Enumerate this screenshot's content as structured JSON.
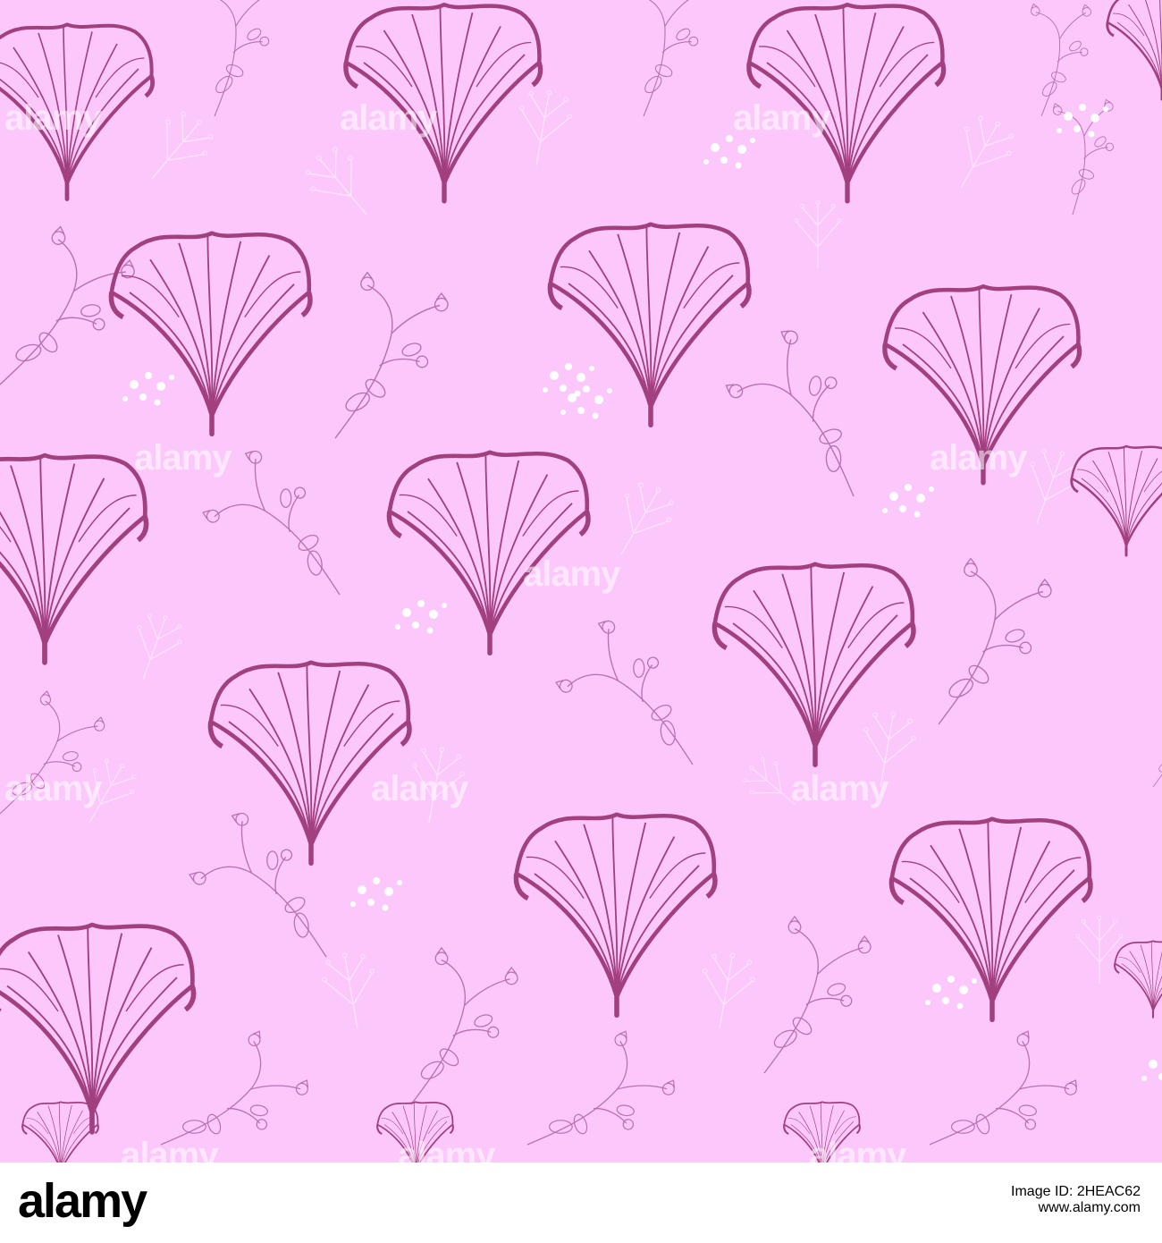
{
  "image": {
    "description": "Seamless pattern of ginkgo-like fan leaves with small wildflower sprigs on a pink background",
    "background_color": "#fcc8fb",
    "leaf_color": "#a2407f",
    "sprig_color": "#b871b2",
    "light_sprig_color": "#ffe7ff",
    "dot_color": "#ffffff"
  },
  "watermark": {
    "text": "alamy"
  },
  "footer": {
    "logo": "alamy",
    "image_id_label": "Image ID:",
    "image_id": "2HEAC62",
    "url": "www.alamy.com"
  }
}
